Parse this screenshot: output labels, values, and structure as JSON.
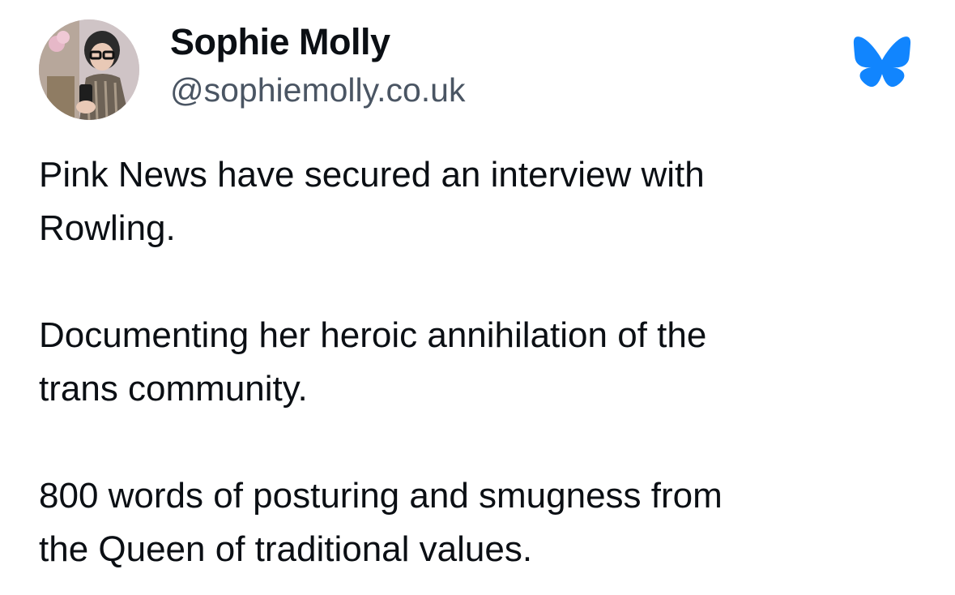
{
  "author": {
    "display_name": "Sophie Molly",
    "handle": "@sophiemolly.co.uk",
    "avatar_icon": "profile-photo"
  },
  "platform": {
    "logo_icon": "bluesky-butterfly-icon",
    "brand_color": "#1185fe"
  },
  "post": {
    "paragraphs": [
      "Pink News have secured an interview with\nRowling.",
      "Documenting her heroic annihilation of the\ntrans community.",
      "800 words of posturing and smugness from\nthe Queen of traditional values."
    ]
  }
}
